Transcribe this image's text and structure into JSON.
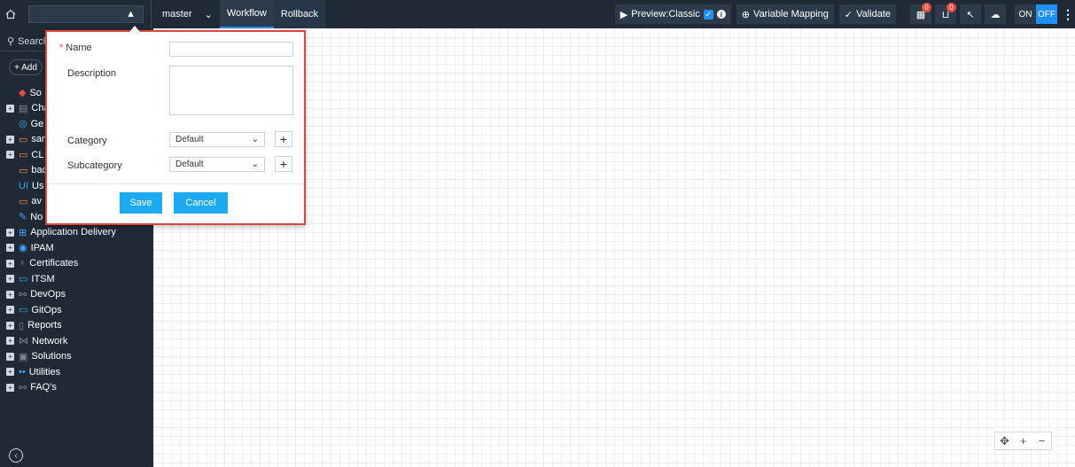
{
  "topbar": {
    "branch": "master",
    "tabs": [
      "Workflow",
      "Rollback"
    ],
    "preview_label": "Preview:Classic",
    "variable_mapping_label": "Variable Mapping",
    "validate_label": "Validate",
    "badge_a": "0",
    "badge_b": "0",
    "toggle_on": "ON",
    "toggle_off": "OFF"
  },
  "sidebar": {
    "search_placeholder": "Search",
    "add_label": "+ Add",
    "items": [
      {
        "label": "So",
        "icon": "diamond-icon",
        "color": "#e74c3c",
        "expandable": false
      },
      {
        "label": "Cha",
        "icon": "chart-icon",
        "color": "#7c8a99",
        "expandable": true
      },
      {
        "label": "Ge",
        "icon": "overlap-icon",
        "color": "#3fa7ff",
        "expandable": false
      },
      {
        "label": "sam",
        "icon": "folder-icon",
        "color": "#ff8a3d",
        "expandable": true
      },
      {
        "label": "CL",
        "icon": "folder-icon",
        "color": "#ff8a3d",
        "expandable": true
      },
      {
        "label": "bac",
        "icon": "folder-icon",
        "color": "#ff8a3d",
        "expandable": false
      },
      {
        "label": "Us",
        "icon": "ui-icon",
        "color": "#3fa7ff",
        "expandable": false
      },
      {
        "label": "av",
        "icon": "folder-icon",
        "color": "#ff8a3d",
        "expandable": false
      },
      {
        "label": "No",
        "icon": "note-icon",
        "color": "#3fa7ff",
        "expandable": false
      },
      {
        "label": "Application Delivery",
        "icon": "grid-icon",
        "color": "#3fa7ff",
        "expandable": true
      },
      {
        "label": "IPAM",
        "icon": "target-icon",
        "color": "#3fa7ff",
        "expandable": true
      },
      {
        "label": "Certificates",
        "icon": "bulb-icon",
        "color": "#7c8a99",
        "expandable": true
      },
      {
        "label": "ITSM",
        "icon": "folder-icon",
        "color": "#3fa7ff",
        "expandable": true
      },
      {
        "label": "DevOps",
        "icon": "link-icon",
        "color": "#7c8a99",
        "expandable": true
      },
      {
        "label": "GitOps",
        "icon": "folder-icon",
        "color": "#3fa7ff",
        "expandable": true
      },
      {
        "label": "Reports",
        "icon": "doc-icon",
        "color": "#7c8a99",
        "expandable": true
      },
      {
        "label": "Network",
        "icon": "network-icon",
        "color": "#7c8a99",
        "expandable": true
      },
      {
        "label": "Solutions",
        "icon": "puzzle-icon",
        "color": "#7c8a99",
        "expandable": true
      },
      {
        "label": "Utilities",
        "icon": "dots-icon",
        "color": "#3fa7ff",
        "expandable": true
      },
      {
        "label": "FAQ's",
        "icon": "link-icon",
        "color": "#7c8a99",
        "expandable": true
      }
    ]
  },
  "modal": {
    "name_label": "Name",
    "required_mark": "*",
    "description_label": "Description",
    "category_label": "Category",
    "category_value": "Default",
    "subcategory_label": "Subcategory",
    "subcategory_value": "Default",
    "save_label": "Save",
    "cancel_label": "Cancel"
  },
  "colors": {
    "accent": "#1eaaf1",
    "highlight_border": "#e0453a",
    "dark_bg": "#1f2a36"
  }
}
